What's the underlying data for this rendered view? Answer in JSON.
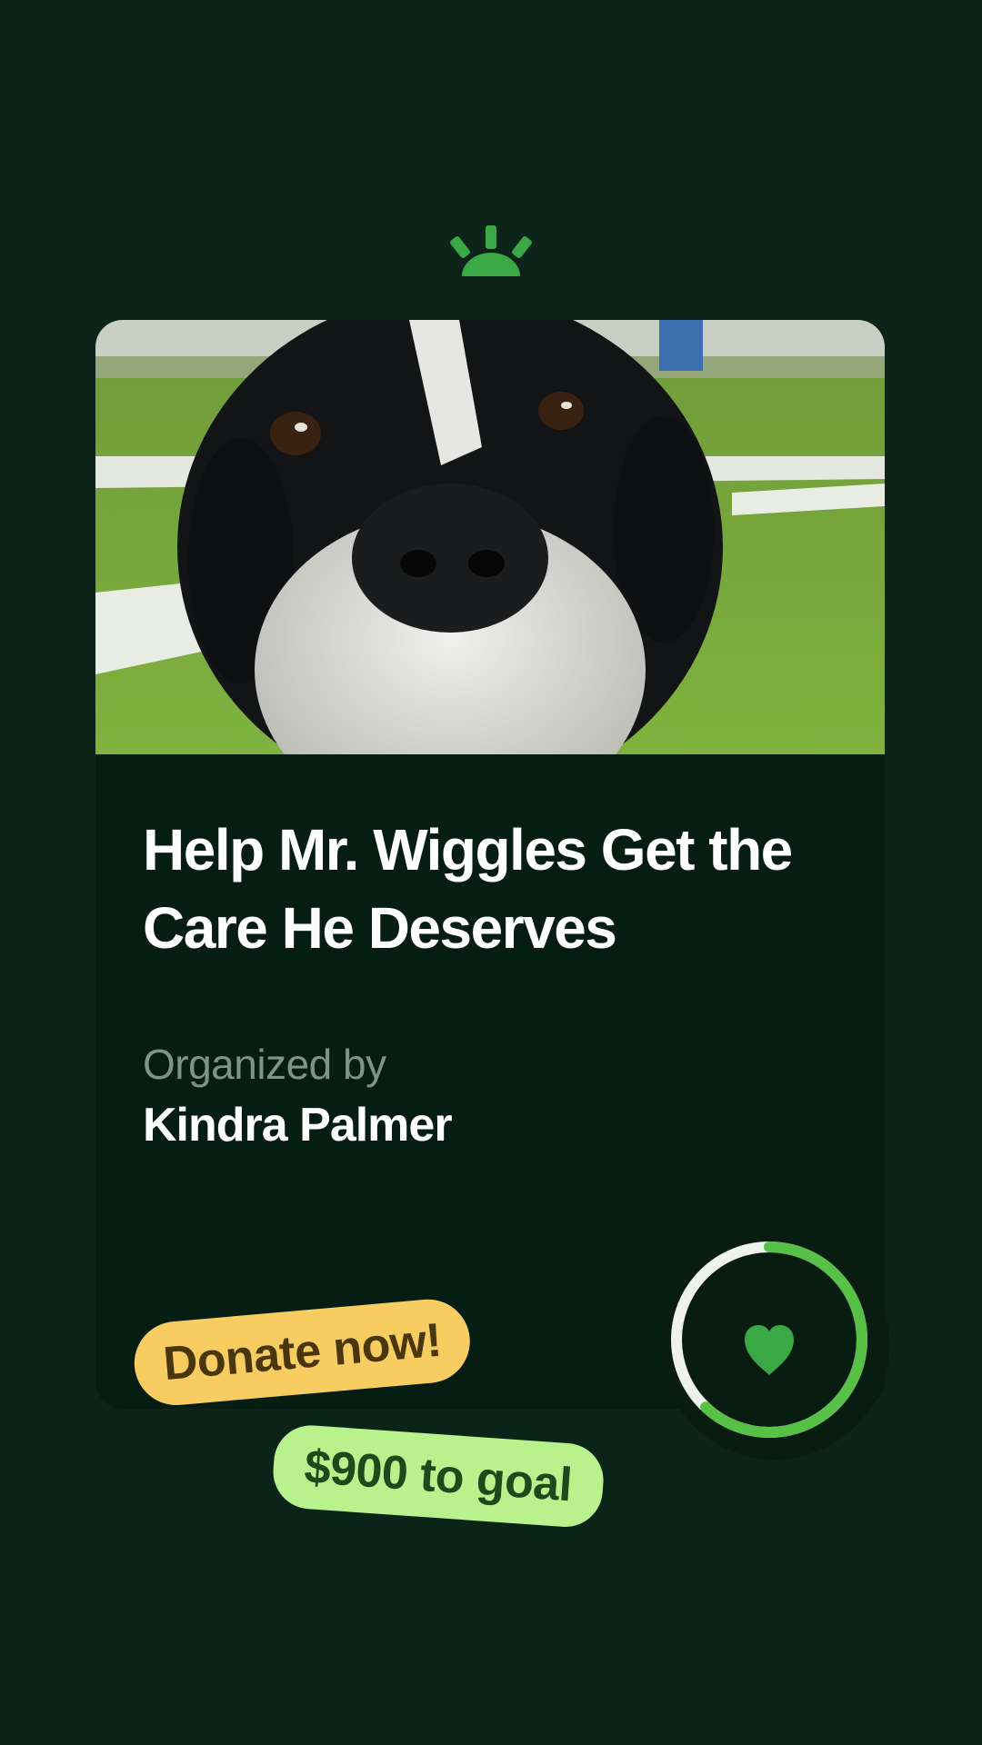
{
  "campaign": {
    "title": "Help Mr. Wiggles Get the Care He Deserves",
    "organizer_label": "Organized by",
    "organizer_name": "Kindra Palmer",
    "donate_label": "Donate now!",
    "goal_label": "$900 to goal",
    "progress_fraction": 0.62
  },
  "icons": {
    "brand": "sunrise-logo-icon",
    "heart": "heart-icon"
  },
  "colors": {
    "background": "#0c2419",
    "card": "#061d13",
    "brand_green": "#3aa845",
    "donate_pill": "#f7cd62",
    "goal_pill": "#b9f28c",
    "ring_track": "#eef1ee",
    "ring_progress": "#57c047"
  }
}
